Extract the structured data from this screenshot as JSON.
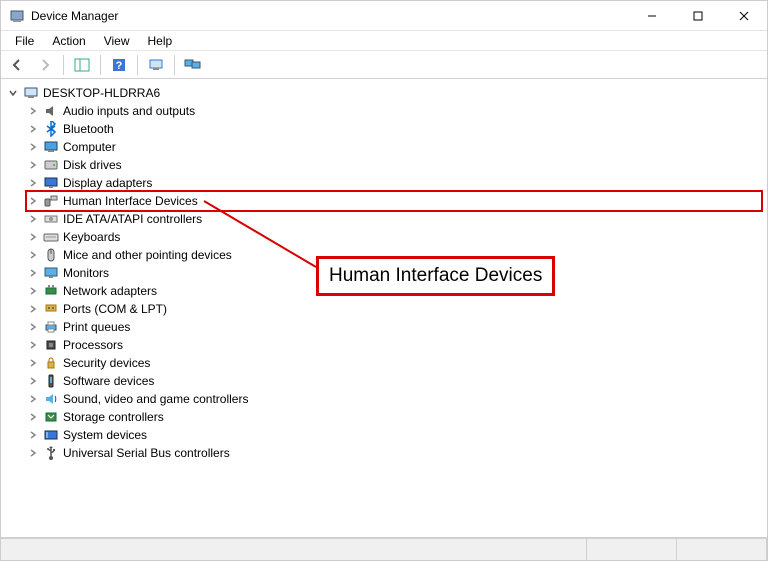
{
  "window": {
    "title": "Device Manager"
  },
  "menubar": {
    "items": [
      "File",
      "Action",
      "View",
      "Help"
    ]
  },
  "tree": {
    "root_label": "DESKTOP-HLDRRA6",
    "categories": [
      {
        "label": "Audio inputs and outputs",
        "icon": "audio"
      },
      {
        "label": "Bluetooth",
        "icon": "bluetooth"
      },
      {
        "label": "Computer",
        "icon": "computer"
      },
      {
        "label": "Disk drives",
        "icon": "disk"
      },
      {
        "label": "Display adapters",
        "icon": "display"
      },
      {
        "label": "Human Interface Devices",
        "icon": "hid",
        "highlighted": true
      },
      {
        "label": "IDE ATA/ATAPI controllers",
        "icon": "ide"
      },
      {
        "label": "Keyboards",
        "icon": "keyboard"
      },
      {
        "label": "Mice and other pointing devices",
        "icon": "mouse"
      },
      {
        "label": "Monitors",
        "icon": "monitor"
      },
      {
        "label": "Network adapters",
        "icon": "network"
      },
      {
        "label": "Ports (COM & LPT)",
        "icon": "ports"
      },
      {
        "label": "Print queues",
        "icon": "printer"
      },
      {
        "label": "Processors",
        "icon": "cpu"
      },
      {
        "label": "Security devices",
        "icon": "security"
      },
      {
        "label": "Software devices",
        "icon": "software"
      },
      {
        "label": "Sound, video and game controllers",
        "icon": "sound"
      },
      {
        "label": "Storage controllers",
        "icon": "storage"
      },
      {
        "label": "System devices",
        "icon": "system"
      },
      {
        "label": "Universal Serial Bus controllers",
        "icon": "usb"
      }
    ]
  },
  "annotation": {
    "callout_text": "Human Interface Devices"
  }
}
